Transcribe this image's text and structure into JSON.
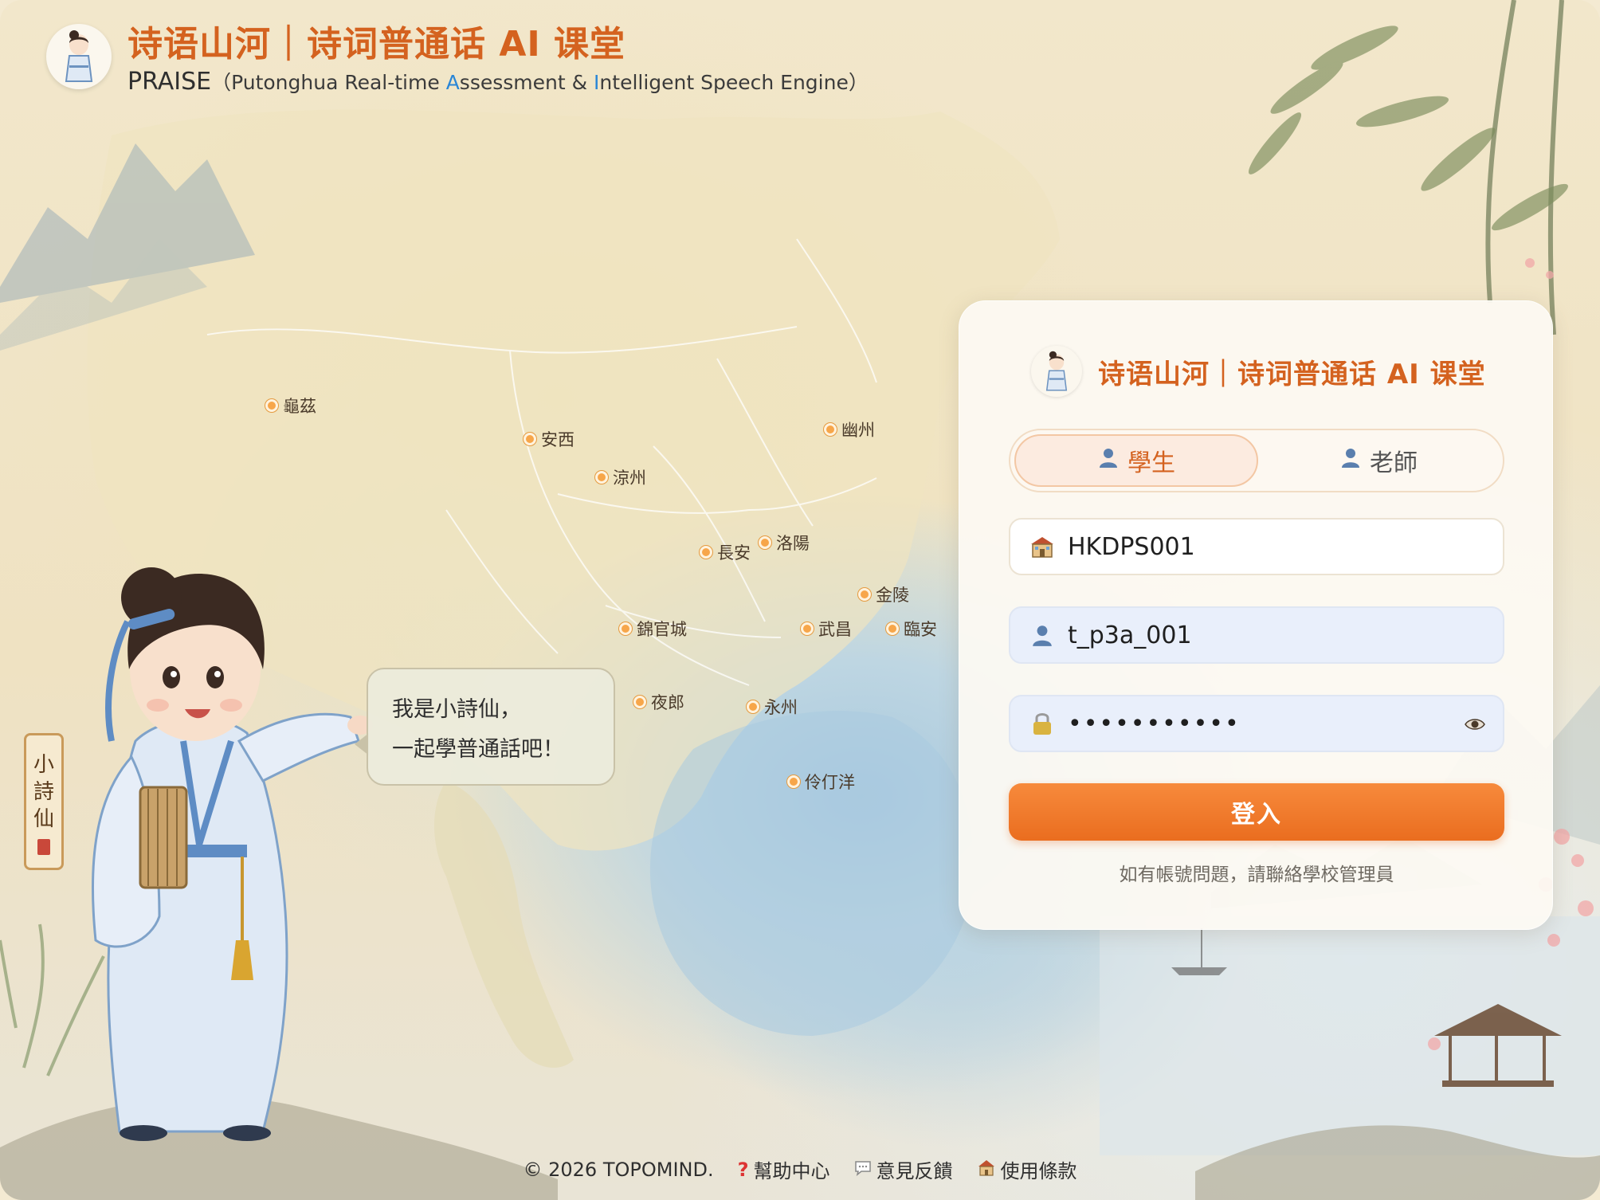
{
  "header": {
    "title": "诗语山河｜诗词普通话 AI 课堂",
    "sub_praise": "PRAISE",
    "sub_open": "（Putonghua Real-time ",
    "sub_a": "A",
    "sub_mid": "ssessment & ",
    "sub_i": "I",
    "sub_end": "ntelligent Speech Engine）"
  },
  "map": {
    "cities": [
      "龜茲",
      "安西",
      "涼州",
      "幽州",
      "長安",
      "洛陽",
      "金陵",
      "錦官城",
      "武昌",
      "臨安",
      "夜郎",
      "永州",
      "伶仃洋"
    ]
  },
  "mascot": {
    "bubble_line1": "我是小詩仙，",
    "bubble_line2": "一起學普通話吧！",
    "seal_chars": [
      "小",
      "詩",
      "仙"
    ]
  },
  "login": {
    "title": "诗语山河｜诗词普通话 AI 课堂",
    "tab_student": "學生",
    "tab_teacher": "老師",
    "school_code": "HKDPS001",
    "username": "t_p3a_001",
    "password_mask": "•••••••••••",
    "submit": "登入",
    "help": "如有帳號問題，請聯絡學校管理員"
  },
  "footer": {
    "copyright": "© 2026 TOPOMIND.",
    "help_center": "幫助中心",
    "feedback": "意見反饋",
    "terms": "使用條款"
  },
  "colors": {
    "accent": "#d4621f",
    "button": "#ee7528",
    "input_fill": "#e9effb"
  }
}
